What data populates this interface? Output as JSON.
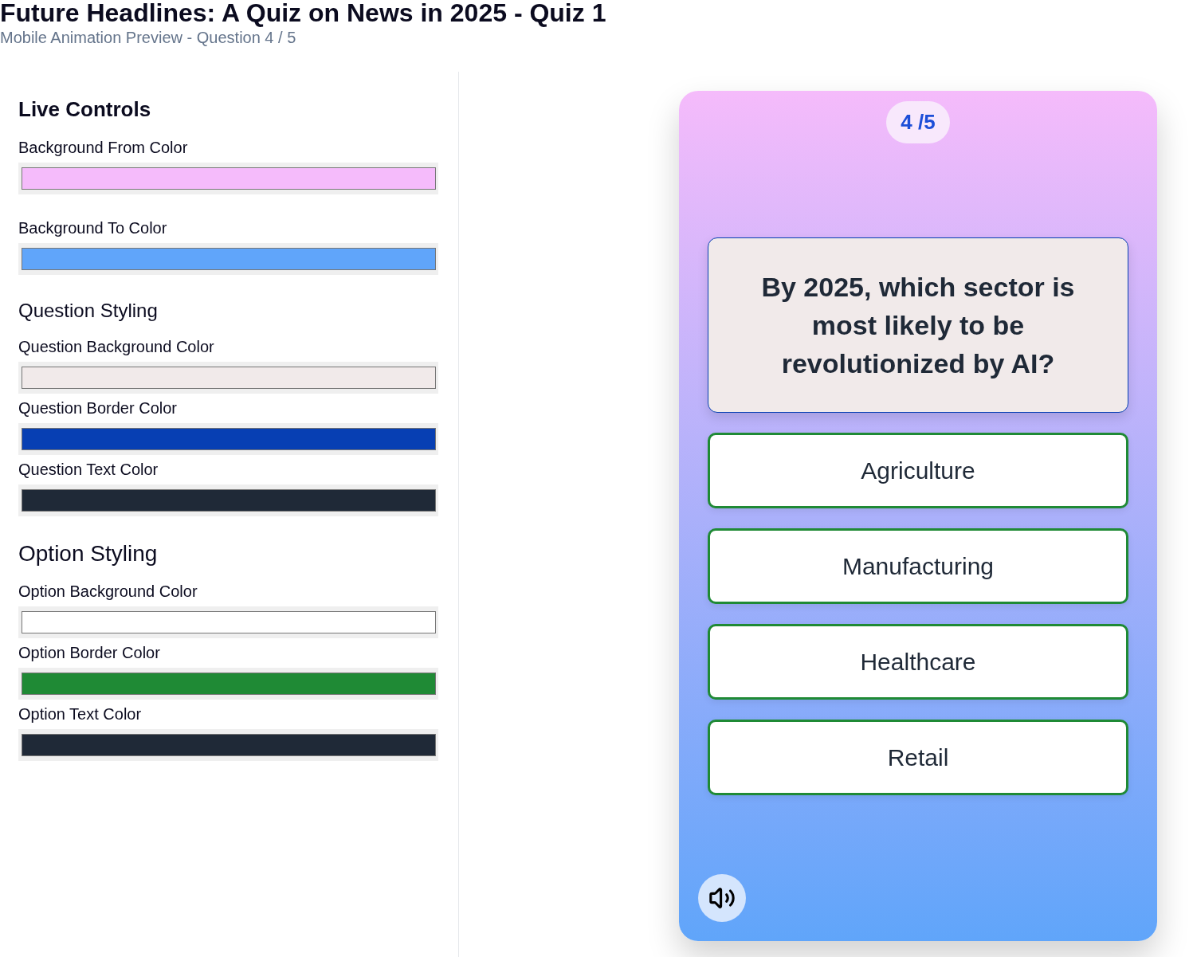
{
  "header": {
    "title": "Future Headlines: A Quiz on News in 2025 - Quiz 1",
    "subtitle": "Mobile Animation Preview - Question 4 / 5"
  },
  "controls": {
    "title": "Live Controls",
    "sections": [
      {
        "kind": "plain",
        "fields": [
          {
            "label": "Background From Color",
            "color": "#f5bbfb"
          },
          {
            "label": "Background To Color",
            "color": "#60a5fa"
          }
        ]
      },
      {
        "kind": "subsection",
        "heading": "Question Styling",
        "fields": [
          {
            "label": "Question Background Color",
            "color": "#f1eaea"
          },
          {
            "label": "Question Border Color",
            "color": "#073fb3"
          },
          {
            "label": "Question Text Color",
            "color": "#1f2937"
          }
        ]
      },
      {
        "kind": "section",
        "heading": "Option Styling",
        "fields": [
          {
            "label": "Option Background Color",
            "color": "#ffffff"
          },
          {
            "label": "Option Border Color",
            "color": "#1f8a35"
          },
          {
            "label": "Option Text Color",
            "color": "#1f2937"
          }
        ]
      }
    ]
  },
  "preview": {
    "progress": "4 /5",
    "question": "By 2025, which sector is most likely to be revolutionized by AI?",
    "options": [
      {
        "label": "Agriculture"
      },
      {
        "label": "Manufacturing"
      },
      {
        "label": "Healthcare"
      },
      {
        "label": "Retail"
      }
    ]
  }
}
